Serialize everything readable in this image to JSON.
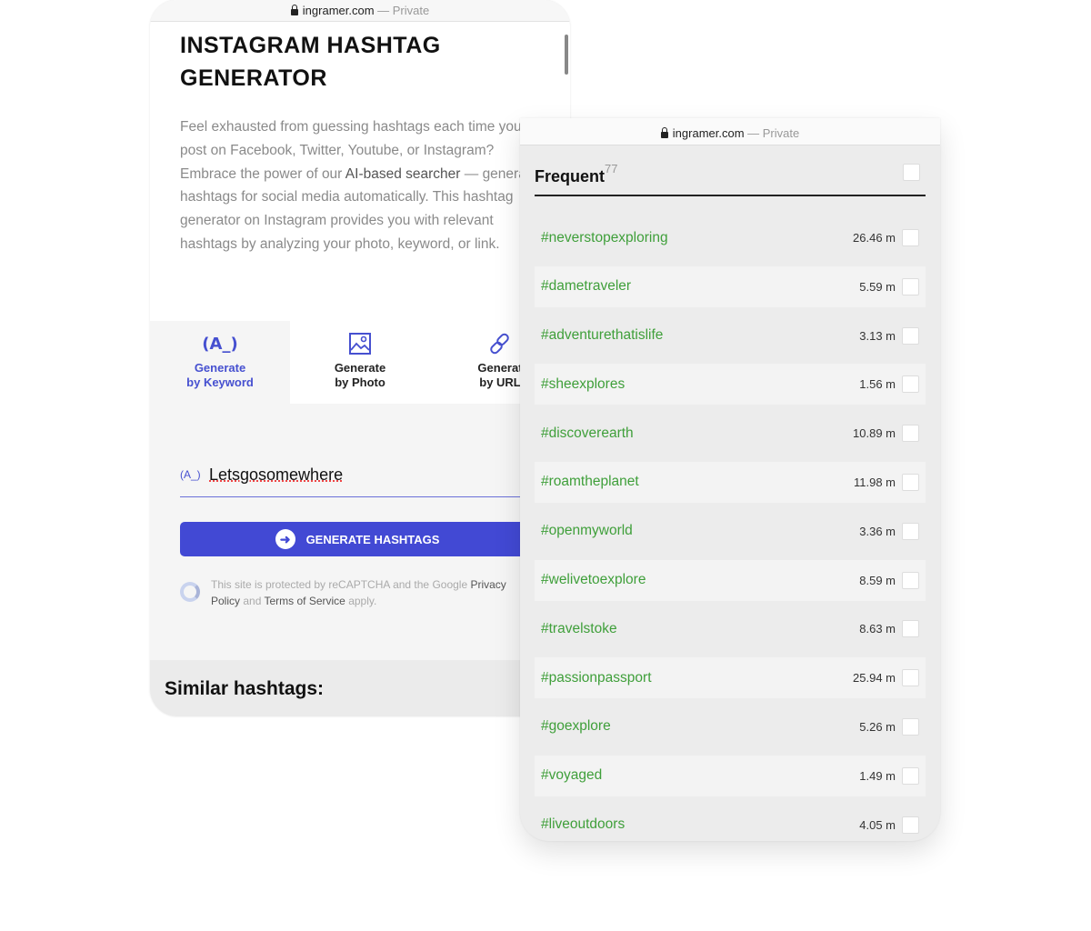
{
  "left": {
    "urlbar": {
      "domain": "ingramer.com",
      "suffix": " — Private"
    },
    "title_line1": "INSTAGRAM HASHTAG",
    "title_line2": "GENERATOR",
    "description": {
      "line1": "Feel exhausted from guessing hashtags each time you",
      "line2": "post on Facebook, Twitter, Youtube, or Instagram?",
      "line3_pre": "Embrace the power of our ",
      "line3_bold": "AI-based searcher",
      "line3_post": " — genera",
      "line4": "hashtags for social media automatically. This hashtag",
      "line5": "generator on Instagram provides you with relevant",
      "line6": "hashtags by analyzing your photo, keyword, or link."
    },
    "tabs": [
      {
        "line1": "Generate",
        "line2": "by Keyword",
        "icon": "keyword-icon"
      },
      {
        "line1": "Generate",
        "line2": "by Photo",
        "icon": "image-icon"
      },
      {
        "line1": "Generat",
        "line2": "by URL",
        "icon": "link-icon"
      }
    ],
    "keyword_icon": "(A_)",
    "keyword_value": "Letsgosomewhere",
    "generate_label": "GENERATE HASHTAGS",
    "recaptcha": {
      "t1": "This site is protected by reCAPTCHA and the Google ",
      "privacy1": "Privacy",
      "privacy2": "Policy",
      "and": " and ",
      "terms": "Terms of Service",
      "apply": " apply."
    },
    "similar_title": "Similar hashtags:",
    "accent": "#4249d4"
  },
  "right": {
    "urlbar": {
      "domain": "ingramer.com",
      "suffix": " — Private"
    },
    "header": "Frequent",
    "count": "77",
    "tag_color": "#3f9f3a",
    "rows": [
      {
        "tag": "#neverstopexploring",
        "count": "26.46 m"
      },
      {
        "tag": "#dametraveler",
        "count": "5.59 m"
      },
      {
        "tag": "#adventurethatislife",
        "count": "3.13 m"
      },
      {
        "tag": "#sheexplores",
        "count": "1.56 m"
      },
      {
        "tag": "#discoverearth",
        "count": "10.89 m"
      },
      {
        "tag": "#roamtheplanet",
        "count": "11.98 m"
      },
      {
        "tag": "#openmyworld",
        "count": "3.36 m"
      },
      {
        "tag": "#welivetoexplore",
        "count": "8.59 m"
      },
      {
        "tag": "#travelstoke",
        "count": "8.63 m"
      },
      {
        "tag": "#passionpassport",
        "count": "25.94 m"
      },
      {
        "tag": "#goexplore",
        "count": "5.26 m"
      },
      {
        "tag": "#voyaged",
        "count": "1.49 m"
      },
      {
        "tag": "#liveoutdoors",
        "count": "4.05 m"
      }
    ]
  }
}
